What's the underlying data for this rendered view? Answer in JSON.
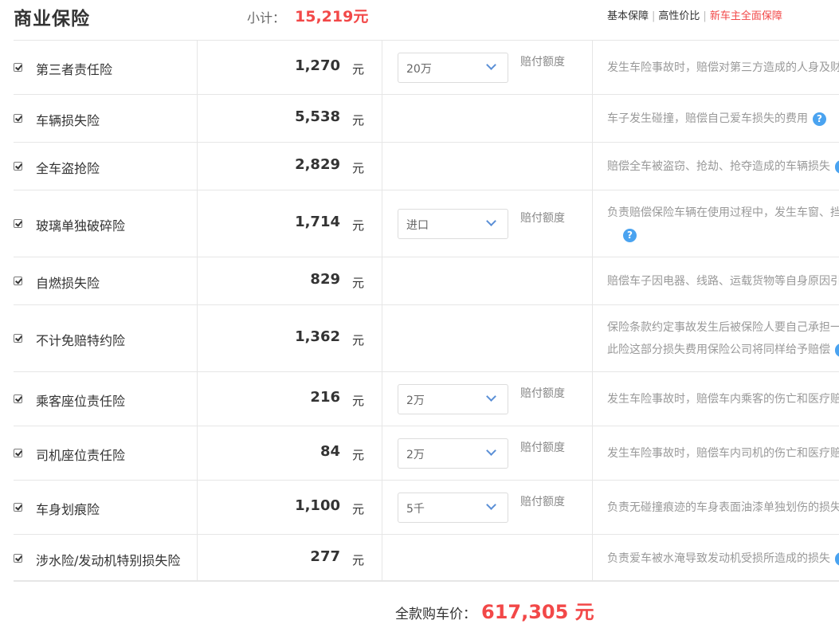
{
  "header": {
    "title": "商业保险",
    "subtotal_label": "小计：",
    "subtotal_value": "15,219元",
    "plans": [
      "基本保障",
      "高性价比",
      "新车主全面保障"
    ]
  },
  "unit": "元",
  "amount_label": "赔付额度",
  "items": [
    {
      "name": "第三者责任险",
      "price": "1,270",
      "option": "20万",
      "desc": [
        "发生车险事故时，赔偿对第三方造成的人身及财"
      ],
      "help": false
    },
    {
      "name": "车辆损失险",
      "price": "5,538",
      "option": null,
      "desc": [
        "车子发生碰撞，赔偿自己爱车损失的费用"
      ],
      "help": "full"
    },
    {
      "name": "全车盗抢险",
      "price": "2,829",
      "option": null,
      "desc": [
        "赔偿全车被盗窃、抢劫、抢夺造成的车辆损失"
      ],
      "help": "cut"
    },
    {
      "name": "玻璃单独破碎险",
      "price": "1,714",
      "option": "进口",
      "desc": [
        "负责赔偿保险车辆在使用过程中，发生车窗、挡"
      ],
      "help": "line2"
    },
    {
      "name": "自燃损失险",
      "price": "829",
      "option": null,
      "desc": [
        "赔偿车子因电器、线路、运载货物等自身原因引"
      ],
      "help": false
    },
    {
      "name": "不计免赔特约险",
      "price": "1,362",
      "option": null,
      "desc": [
        "保险条款约定事故发生后被保险人要自己承担一",
        "此险这部分损失费用保险公司将同样给予赔偿"
      ],
      "help": "cut2"
    },
    {
      "name": "乘客座位责任险",
      "price": "216",
      "option": "2万",
      "desc": [
        "发生车险事故时，赔偿车内乘客的伤亡和医疗赔"
      ],
      "help": false
    },
    {
      "name": "司机座位责任险",
      "price": "84",
      "option": "2万",
      "desc": [
        "发生车险事故时，赔偿车内司机的伤亡和医疗赔"
      ],
      "help": false
    },
    {
      "name": "车身划痕险",
      "price": "1,100",
      "option": "5千",
      "desc": [
        "负责无碰撞痕迹的车身表面油漆单独划伤的损失"
      ],
      "help": false
    },
    {
      "name": "涉水险/发动机特别损失险",
      "price": "277",
      "option": null,
      "desc": [
        "负责爱车被水淹导致发动机受损所造成的损失"
      ],
      "help": "cut"
    }
  ],
  "total": {
    "label": "全款购车价：",
    "value": "617,305 元"
  }
}
